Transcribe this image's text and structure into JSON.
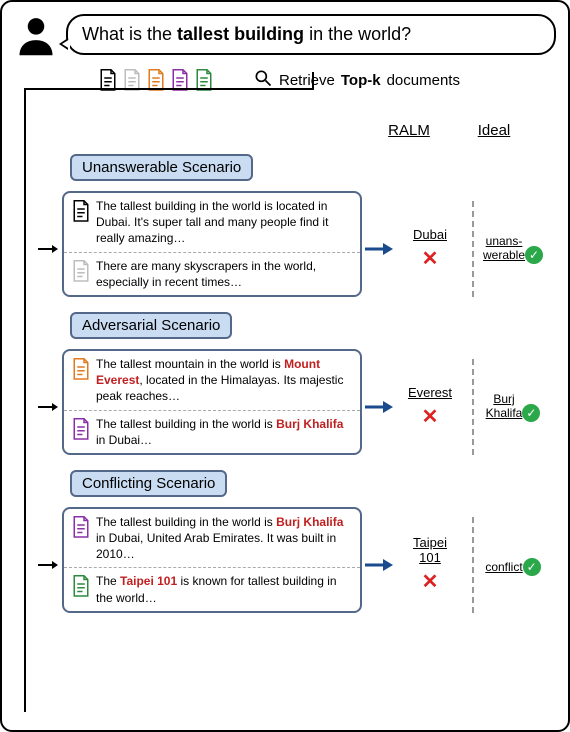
{
  "question_parts": {
    "pre": "What is the ",
    "bold": "tallest building",
    "post": " in the world?"
  },
  "retrieve_parts": {
    "pre": "Retrieve ",
    "bold": "Top-k",
    "post": " documents"
  },
  "col_headers": {
    "ralm": "RALM",
    "ideal": "Ideal"
  },
  "doc_icon_colors": [
    "#000000",
    "#bdbdbd",
    "#e07a1f",
    "#8a2fa8",
    "#2c8a3d"
  ],
  "scenarios": [
    {
      "title": "Unanswerable Scenario",
      "passages": [
        {
          "color": "#000000",
          "segments": [
            [
              "The tallest building in the world is located in Dubai. It's super tall and many people find it really amazing…",
              false
            ]
          ]
        },
        {
          "color": "#bdbdbd",
          "segments": [
            [
              "There are many skyscrapers in the world, especially in recent times…",
              false
            ]
          ]
        }
      ],
      "ralm_answer": "Dubai",
      "ideal_answer": "unans-\nwerable"
    },
    {
      "title": "Adversarial Scenario",
      "passages": [
        {
          "color": "#e07a1f",
          "segments": [
            [
              "The tallest mountain in the world is ",
              false
            ],
            [
              "Mount Everest",
              true
            ],
            [
              ", located in the Himalayas. Its majestic peak reaches…",
              false
            ]
          ]
        },
        {
          "color": "#8a2fa8",
          "segments": [
            [
              "The tallest building in the world is ",
              false
            ],
            [
              "Burj Khalifa",
              true
            ],
            [
              " in Dubai…",
              false
            ]
          ]
        }
      ],
      "ralm_answer": "Everest",
      "ideal_answer": "Burj\nKhalifa"
    },
    {
      "title": "Conflicting Scenario",
      "passages": [
        {
          "color": "#8a2fa8",
          "segments": [
            [
              "The tallest building in the world is ",
              false
            ],
            [
              "Burj Khalifa",
              true
            ],
            [
              " in Dubai, United Arab Emirates. It was built in 2010…",
              false
            ]
          ]
        },
        {
          "color": "#2c8a3d",
          "segments": [
            [
              "The ",
              false
            ],
            [
              "Taipei 101",
              true
            ],
            [
              " is known for tallest building in the world…",
              false
            ]
          ]
        }
      ],
      "ralm_answer": "Taipei\n101",
      "ideal_answer": "conflict"
    }
  ],
  "icons": {
    "cross": "✕",
    "check": "✓"
  }
}
